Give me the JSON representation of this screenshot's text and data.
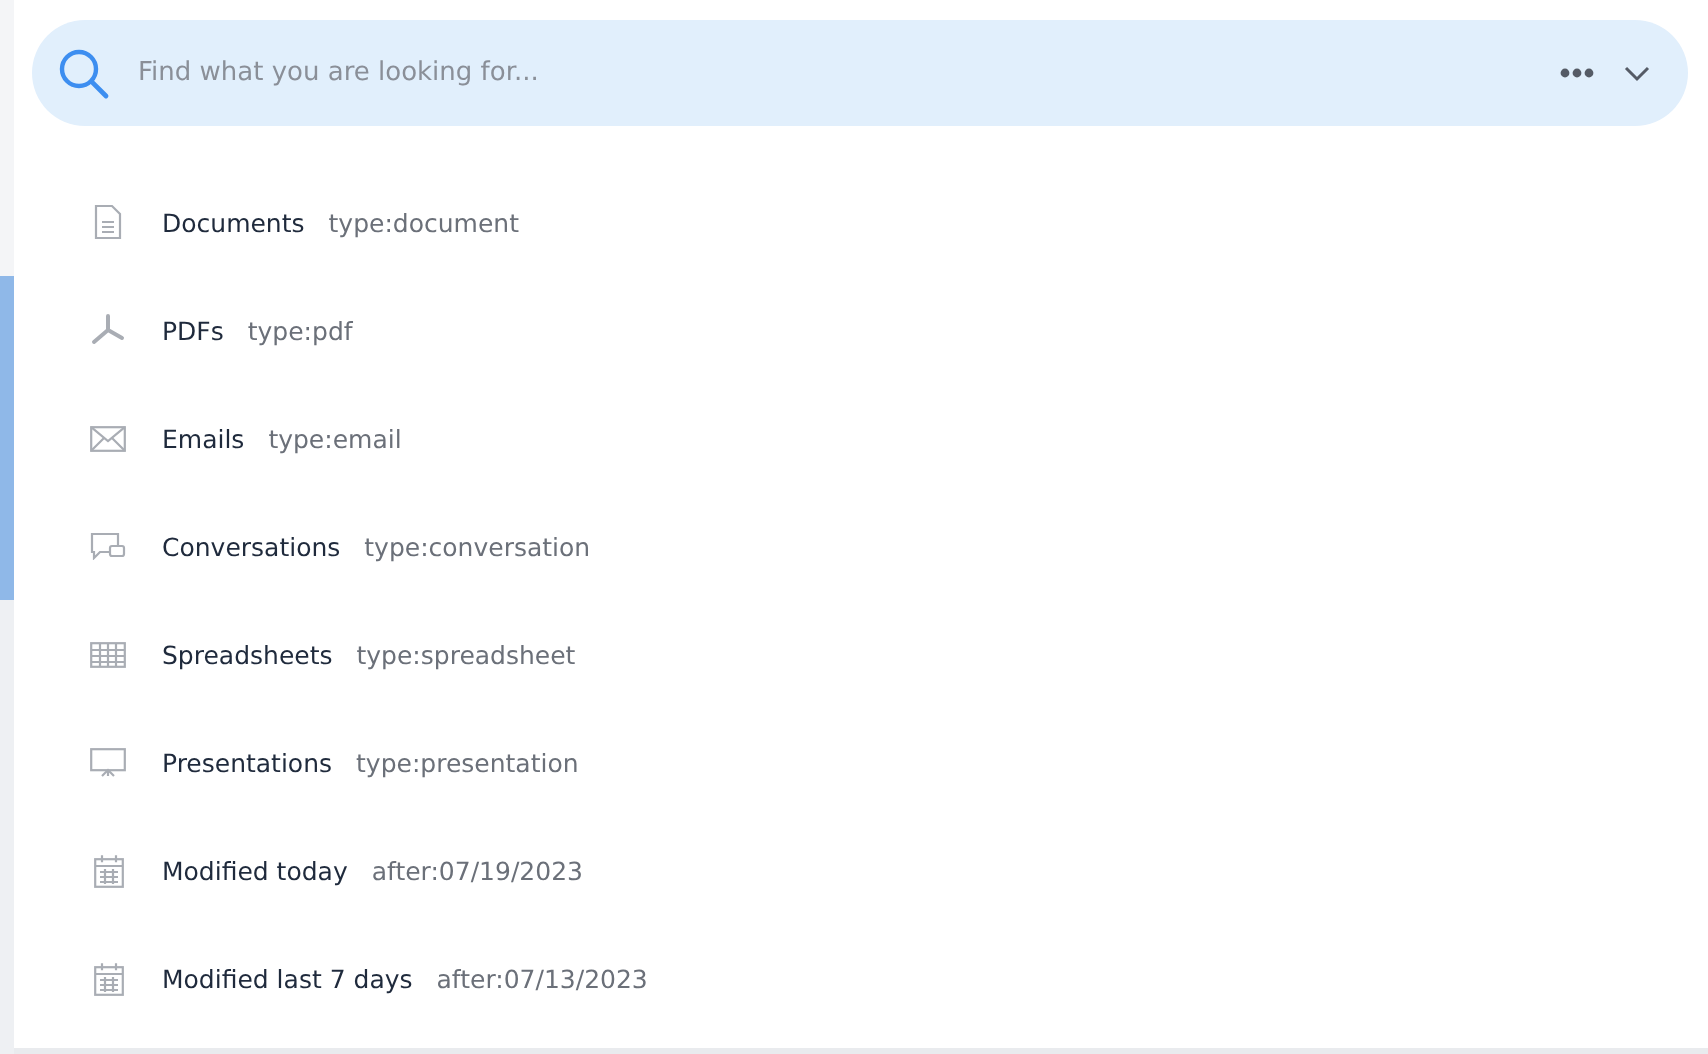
{
  "search": {
    "placeholder": "Find what you are looking for..."
  },
  "suggestions": [
    {
      "kind": "document",
      "label": "Documents",
      "query": "type:document"
    },
    {
      "kind": "pdf",
      "label": "PDFs",
      "query": "type:pdf"
    },
    {
      "kind": "email",
      "label": "Emails",
      "query": "type:email"
    },
    {
      "kind": "conversation",
      "label": "Conversations",
      "query": "type:conversation"
    },
    {
      "kind": "spreadsheet",
      "label": "Spreadsheets",
      "query": "type:spreadsheet"
    },
    {
      "kind": "presentation",
      "label": "Presentations",
      "query": "type:presentation"
    },
    {
      "kind": "calendar",
      "label": "Modified today",
      "query": "after:07/19/2023"
    },
    {
      "kind": "calendar",
      "label": "Modified last 7 days",
      "query": "after:07/13/2023"
    }
  ]
}
